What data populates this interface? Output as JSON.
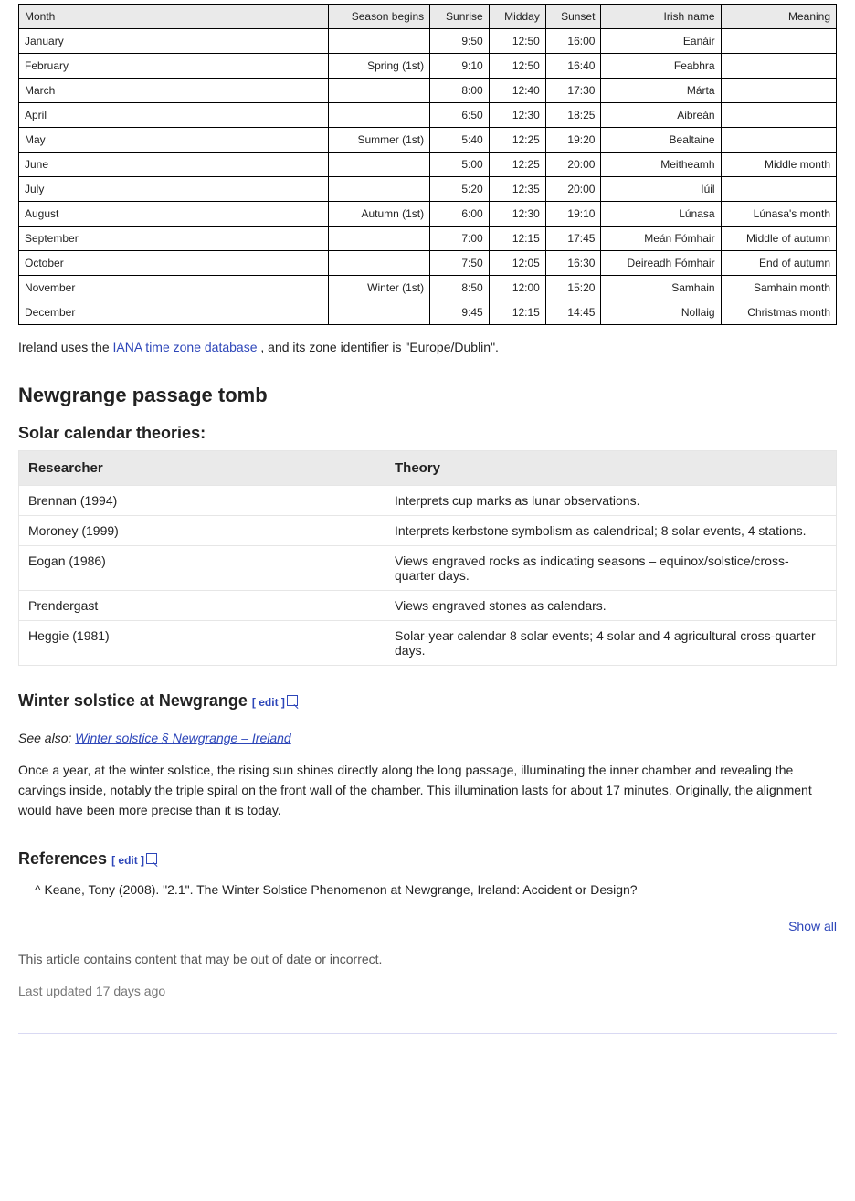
{
  "table1": {
    "headers": [
      "Month",
      "Season begins",
      "Sunrise",
      "Midday",
      "Sunset",
      "Irish name",
      "Meaning"
    ],
    "rows": [
      [
        "January",
        "",
        "9:50",
        "12:50",
        "16:00",
        "Eanáir",
        ""
      ],
      [
        "February",
        "Spring (1st)",
        "9:10",
        "12:50",
        "16:40",
        "Feabhra",
        ""
      ],
      [
        "March",
        "",
        "8:00",
        "12:40",
        "17:30",
        "Márta",
        ""
      ],
      [
        "April",
        "",
        "6:50",
        "12:30",
        "18:25",
        "Aibreán",
        ""
      ],
      [
        "May",
        "Summer (1st)",
        "5:40",
        "12:25",
        "19:20",
        "Bealtaine",
        ""
      ],
      [
        "June",
        "",
        "5:00",
        "12:25",
        "20:00",
        "Meitheamh",
        "Middle month"
      ],
      [
        "July",
        "",
        "5:20",
        "12:35",
        "20:00",
        "Iúil",
        ""
      ],
      [
        "August",
        "Autumn (1st)",
        "6:00",
        "12:30",
        "19:10",
        "Lúnasa",
        "Lúnasa's month"
      ],
      [
        "September",
        "",
        "7:00",
        "12:15",
        "17:45",
        "Meán Fómhair",
        "Middle of autumn"
      ],
      [
        "October",
        "",
        "7:50",
        "12:05",
        "16:30",
        "Deireadh Fómhair",
        "End of autumn"
      ],
      [
        "November",
        "Winter (1st)",
        "8:50",
        "12:00",
        "15:20",
        "Samhain",
        "Samhain month"
      ],
      [
        "December",
        "",
        "9:45",
        "12:15",
        "14:45",
        "Nollaig",
        "Christmas month"
      ]
    ]
  },
  "para1_prefix": "Ireland uses the ",
  "para1_link": "IANA time zone database",
  "para1_suffix": ", and its zone identifier is \"Europe/Dublin\".",
  "section_title": "Newgrange passage tomb",
  "section_sub": "Solar calendar theories:",
  "table2": {
    "headers": [
      "Researcher",
      "Theory"
    ],
    "rows": [
      [
        "Brennan (1994)",
        "Interprets cup marks as lunar observations."
      ],
      [
        "Moroney (1999)",
        "Interprets kerbstone symbolism as calendrical; 8 solar events, 4 stations."
      ],
      [
        "Eogan (1986)",
        "Views engraved rocks as indicating seasons – equinox/solstice/cross-quarter days."
      ],
      [
        "Prendergast",
        "Views engraved stones as calendars."
      ],
      [
        "Heggie (1981)",
        "Solar-year calendar 8 solar events; 4 solar and 4 agricultural cross-quarter days."
      ]
    ]
  },
  "winter_solstice": {
    "title": "Winter solstice at Newgrange ",
    "edit": "[ edit ]",
    "para_prefix": "See also: ",
    "para_link": "Winter solstice § Newgrange – Ireland",
    "body": "Once a year, at the winter solstice, the rising sun shines directly along the long passage, illuminating the inner chamber and revealing the carvings inside, notably the triple spiral on the front wall of the chamber. This illumination lasts for about 17 minutes. Originally, the alignment would have been more precise than it is today."
  },
  "references": {
    "title": "References ",
    "edit": "[ edit ]",
    "list": [
      "^ Keane, Tony (2008). \"2.1\". The Winter Solstice Phenomenon at Newgrange, Ireland: Accident or Design?"
    ],
    "show_link": "Show all"
  },
  "footer": {
    "notice": "This article contains content that may be out of date or incorrect.",
    "last_updated_label": "Last updated ",
    "last_updated": "17 days ago"
  }
}
